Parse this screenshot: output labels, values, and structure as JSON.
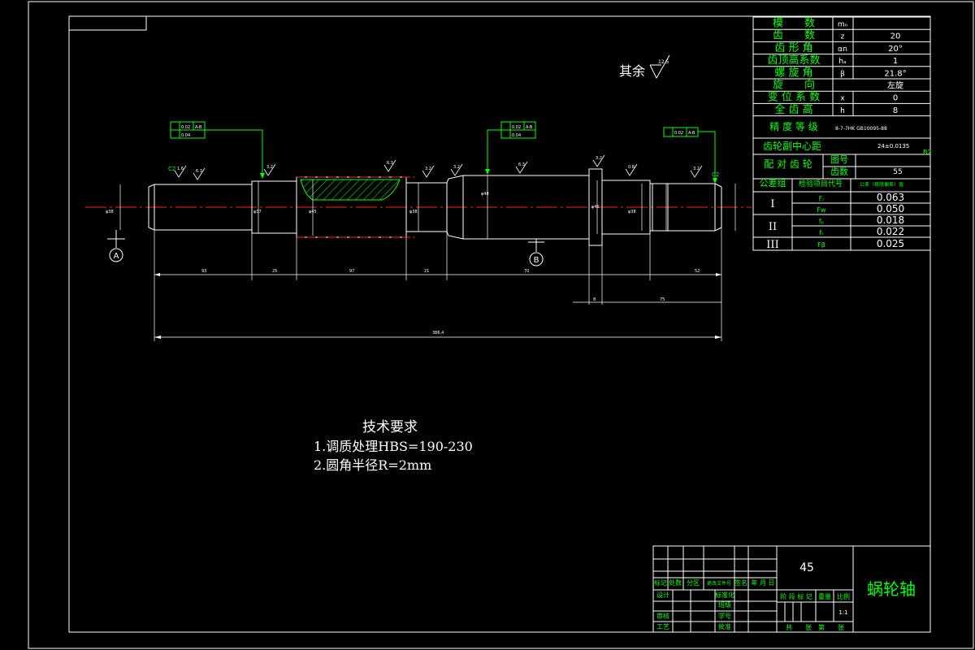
{
  "params_table": {
    "rows": [
      {
        "name": "模　　数",
        "symbol": "mₙ",
        "value": ""
      },
      {
        "name": "齿　　数",
        "symbol": "z",
        "value": "20"
      },
      {
        "name": "齿 形 角",
        "symbol": "αn",
        "value": "20°"
      },
      {
        "name": "齿顶高系数",
        "symbol": "hₐ",
        "value": "1"
      },
      {
        "name": "螺 旋 角",
        "symbol": "β",
        "value": "21.8°"
      },
      {
        "name": "旋　　向",
        "symbol": "",
        "value": "左旋"
      },
      {
        "name": "变 位 系 数",
        "symbol": "x",
        "value": "0"
      },
      {
        "name": "全 齿 高",
        "symbol": "h",
        "value": "8"
      }
    ],
    "accuracy_label": "精 度 等 级",
    "accuracy_value": "8-7-7HK GB10095-88",
    "center_distance_label": "齿轮副中心距",
    "center_distance_value": "24±0.0135",
    "center_distance_note": "B2",
    "mating_gear_label": "配 对 齿 轮",
    "drawing_no_label": "图号",
    "teeth_label": "齿数",
    "teeth_value": "55",
    "header_group": "公差组",
    "header_item": "检验项目代号",
    "header_tol": "公差（极限偏差）值",
    "groups": [
      {
        "label": "I",
        "items": [
          {
            "code": "Fᵣ",
            "value": "0.063"
          },
          {
            "code": "Fw",
            "value": "0.050"
          }
        ]
      },
      {
        "label": "II",
        "items": [
          {
            "code": "fₚ",
            "value": "0.018"
          },
          {
            "code": "fₜ",
            "value": "0.022"
          }
        ]
      },
      {
        "label": "III",
        "items": [
          {
            "code": "Fβ",
            "value": "0.025"
          }
        ]
      }
    ]
  },
  "surface_note": {
    "text": "其余",
    "value": "12.5"
  },
  "datums": {
    "a": "A",
    "b": "B"
  },
  "tolerance_frames": [
    {
      "runout": "0.02",
      "datum": "A-B",
      "cyl": "0.04"
    },
    {
      "runout": "0.02",
      "datum": "A-B",
      "cyl": "0.04"
    },
    {
      "runout": "0.02",
      "datum": "A-B"
    }
  ],
  "chamfer": "C2",
  "roughness": {
    "r1": "1.6",
    "r2": "3.2",
    "r3": "6.3",
    "r4": "0.8"
  },
  "dims": {
    "total": "386.4",
    "d1": "φ38",
    "d2": "φ37",
    "d3": "φ45",
    "d4": "φ38",
    "d5": "φ48",
    "d6": "φ46",
    "d7": "φ38",
    "l1": "93",
    "l2": "25",
    "l3": "97",
    "l4": "21",
    "l5": "70",
    "l6": "8",
    "l7": "52",
    "l8": "75"
  },
  "tech": {
    "title": "技术要求",
    "line1": "1.调质处理HBS=190-230",
    "line2": "2.圆角半径R=2mm"
  },
  "title_block": {
    "material": "45",
    "name": "蜗轮轴",
    "marks": "标记",
    "count": "处数",
    "zone": "分区",
    "change_doc": "更改文件号",
    "sign": "签名",
    "date": "年 月 日",
    "design": "设计",
    "standard": "标准化",
    "review": "审核",
    "process": "工艺",
    "approve": "批准",
    "student_no": "学号",
    "class": "班级",
    "stage_mark": "阶 段 标 记",
    "weight": "重量",
    "scale": "比例",
    "scale_value": "1:1",
    "sheets": "共　　张　第　　张"
  }
}
